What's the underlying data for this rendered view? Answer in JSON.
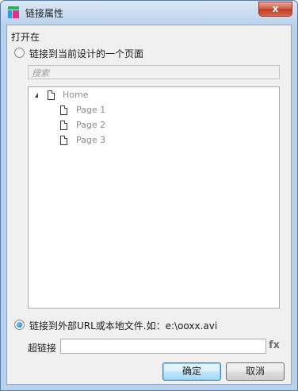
{
  "window": {
    "title": "链接属性",
    "close_label": "x"
  },
  "open_in_label": "打开在",
  "option_page": {
    "label": "链接到当前设计的一个页面",
    "checked": false
  },
  "search": {
    "placeholder": "搜索"
  },
  "tree": {
    "root": {
      "label": "Home",
      "expanded": true
    },
    "children": [
      "Page 1",
      "Page 2",
      "Page 3"
    ]
  },
  "option_url": {
    "label": "链接到外部URL或本地文件.如：e:\\ooxx.avi",
    "checked": true
  },
  "hyperlink": {
    "label": "超链接",
    "value": "",
    "fx_label": "fx"
  },
  "buttons": {
    "ok": "确定",
    "cancel": "取消"
  }
}
